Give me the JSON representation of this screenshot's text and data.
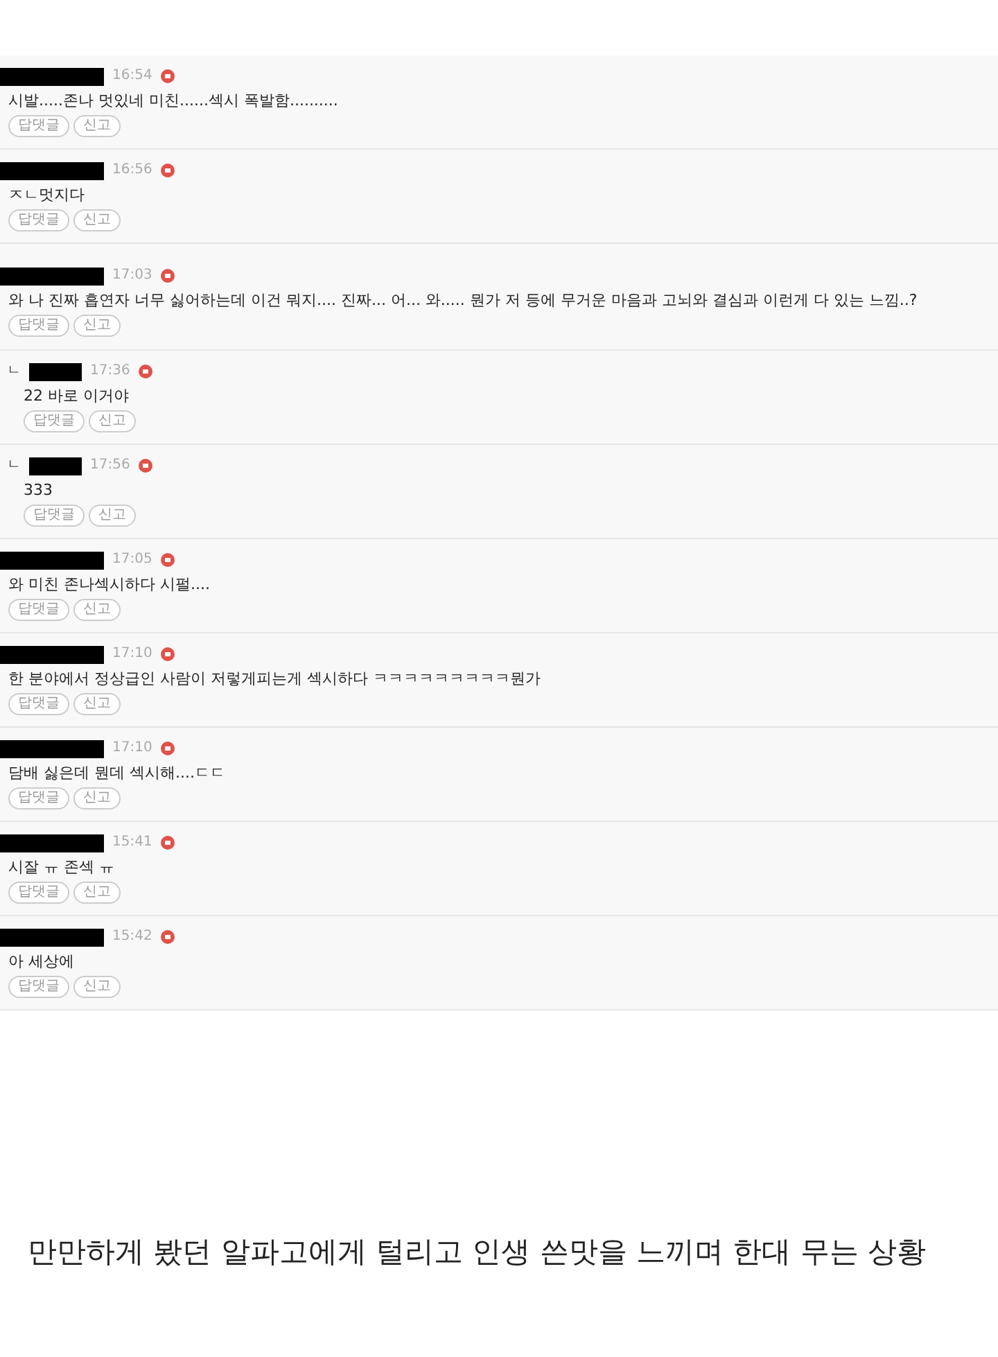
{
  "comments": [
    {
      "kind": "comment",
      "time": "16:54",
      "text": "시발.....존나 멋있네 미친......섹시 폭발함..........",
      "buttons": [
        "답댓글",
        "신고"
      ]
    },
    {
      "kind": "comment",
      "time": "16:56",
      "text": "ㅈㄴ멋지다",
      "buttons": [
        "답댓글",
        "신고"
      ]
    },
    {
      "kind": "comment",
      "time": "17:03",
      "text": "와 나 진짜 흡연자 너무 싫어하는데 이건 뭐지.... 진짜... 어... 와..... 뭔가 저 등에 무거운 마음과 고뇌와 결심과 이런게 다 있는 느낌..?",
      "buttons": [
        "답댓글",
        "신고"
      ]
    },
    {
      "kind": "reply",
      "prefix": "ㄴ",
      "time": "17:36",
      "text": "22 바로 이거야",
      "buttons": [
        "답댓글",
        "신고"
      ]
    },
    {
      "kind": "reply",
      "prefix": "ㄴ",
      "time": "17:56",
      "text": "333",
      "buttons": [
        "답댓글",
        "신고"
      ]
    },
    {
      "kind": "comment",
      "time": "17:05",
      "text": "와 미친 존나섹시하다 시펄....",
      "buttons": [
        "답댓글",
        "신고"
      ]
    },
    {
      "kind": "comment",
      "time": "17:10",
      "text": "한 분야에서 정상급인 사람이 저렇게피는게 섹시하다 ㅋㅋㅋㅋㅋㅋㅋㅋㅋ뭔가",
      "buttons": [
        "답댓글",
        "신고"
      ]
    },
    {
      "kind": "comment",
      "time": "17:10",
      "text": "담배 싫은데 뭔데 섹시해....ㄷㄷ",
      "buttons": [
        "답댓글",
        "신고"
      ]
    },
    {
      "kind": "comment",
      "time": "15:41",
      "text": "시잘 ㅠ 존섹 ㅠ",
      "buttons": [
        "답댓글",
        "신고"
      ]
    },
    {
      "kind": "comment",
      "time": "15:42",
      "text": "아 세상에",
      "buttons": [
        "답댓글",
        "신고"
      ]
    }
  ],
  "caption": "만만하게 봤던 알파고에게 털리고 인생 쓴맛을 느끼며 한대 무는 상황"
}
